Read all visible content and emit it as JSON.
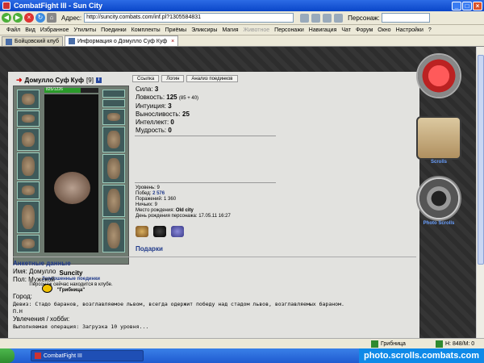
{
  "window": {
    "title": "CombatFight III - Sun City"
  },
  "address": {
    "label": "Адрес:",
    "url": "http://suncity.combats.com/inf.pl?1305584831",
    "persona_label": "Персонаж:"
  },
  "menu": [
    "Файл",
    "Вид",
    "Избранное",
    "Утилиты",
    "Поединки",
    "Комплекты",
    "Приёмы",
    "Эликсиры",
    "Магия",
    "Животное",
    "Персонажи",
    "Навигация",
    "Чат",
    "Форум",
    "Окно",
    "Настройки",
    "?"
  ],
  "tabs": [
    {
      "label": "Бойцовский клуб"
    },
    {
      "label": "Информация о Домулло Суф Куф"
    }
  ],
  "character": {
    "name": "Домулло Суф Куф",
    "level": "[9]",
    "info_badge": "i",
    "hp": "825/1226",
    "hp_fraction": 0.67,
    "links": [
      "Ссылка",
      "Логин",
      "Анализ поединков"
    ],
    "city": "Suncity",
    "completed_fights": "Завершенные поединки",
    "location_text": "Персонаж сейчас находится в клубе.",
    "room": "\"Грибница\""
  },
  "stats": [
    {
      "label": "Сила:",
      "value": "3",
      "extra": ""
    },
    {
      "label": "Ловкость:",
      "value": "125",
      "extra": "(85 + 40)"
    },
    {
      "label": "Интуиция:",
      "value": "3",
      "extra": ""
    },
    {
      "label": "Выносливость:",
      "value": "25",
      "extra": ""
    },
    {
      "label": "Интеллект:",
      "value": "0",
      "extra": ""
    },
    {
      "label": "Мудрость:",
      "value": "0",
      "extra": ""
    }
  ],
  "info": {
    "level_label": "Уровень:",
    "level": "9",
    "wins_label": "Побед:",
    "wins": "2 576",
    "losses_label": "Поражений:",
    "losses": "1 360",
    "draws_label": "Ничьих:",
    "draws": "9",
    "birthplace_label": "Место рождения:",
    "birthplace": "Old city",
    "birthday_label": "День рождения персонажа:",
    "birthday": "17.05.11 16:27"
  },
  "gifts_label": "Подарки",
  "side": {
    "scrolls_label": "Scrolls",
    "photo_label": "Photo Scrolls"
  },
  "profile": {
    "title": "Анкетные данные",
    "name_label": "Имя:",
    "name": "Домулло",
    "sex_label": "Пол:",
    "sex": "Мужской",
    "city_label": "Город:",
    "motto_label": "Девиз:",
    "motto": "Стадо баранов, возглавляемое львом, всегда одержит победу над стадом львов, возглавляемых бараном.",
    "motto_author": "П.Н",
    "hobby_label": "Увлечения / хобби:",
    "loading": "Выполняемая операция:   Загрузка 10 уровня..."
  },
  "status": {
    "site": "Грибница",
    "memory": "H: 848/M: 0"
  },
  "taskbar": {
    "task": "CombatFight III",
    "watermark": "photo.scrolls.combats.com"
  }
}
